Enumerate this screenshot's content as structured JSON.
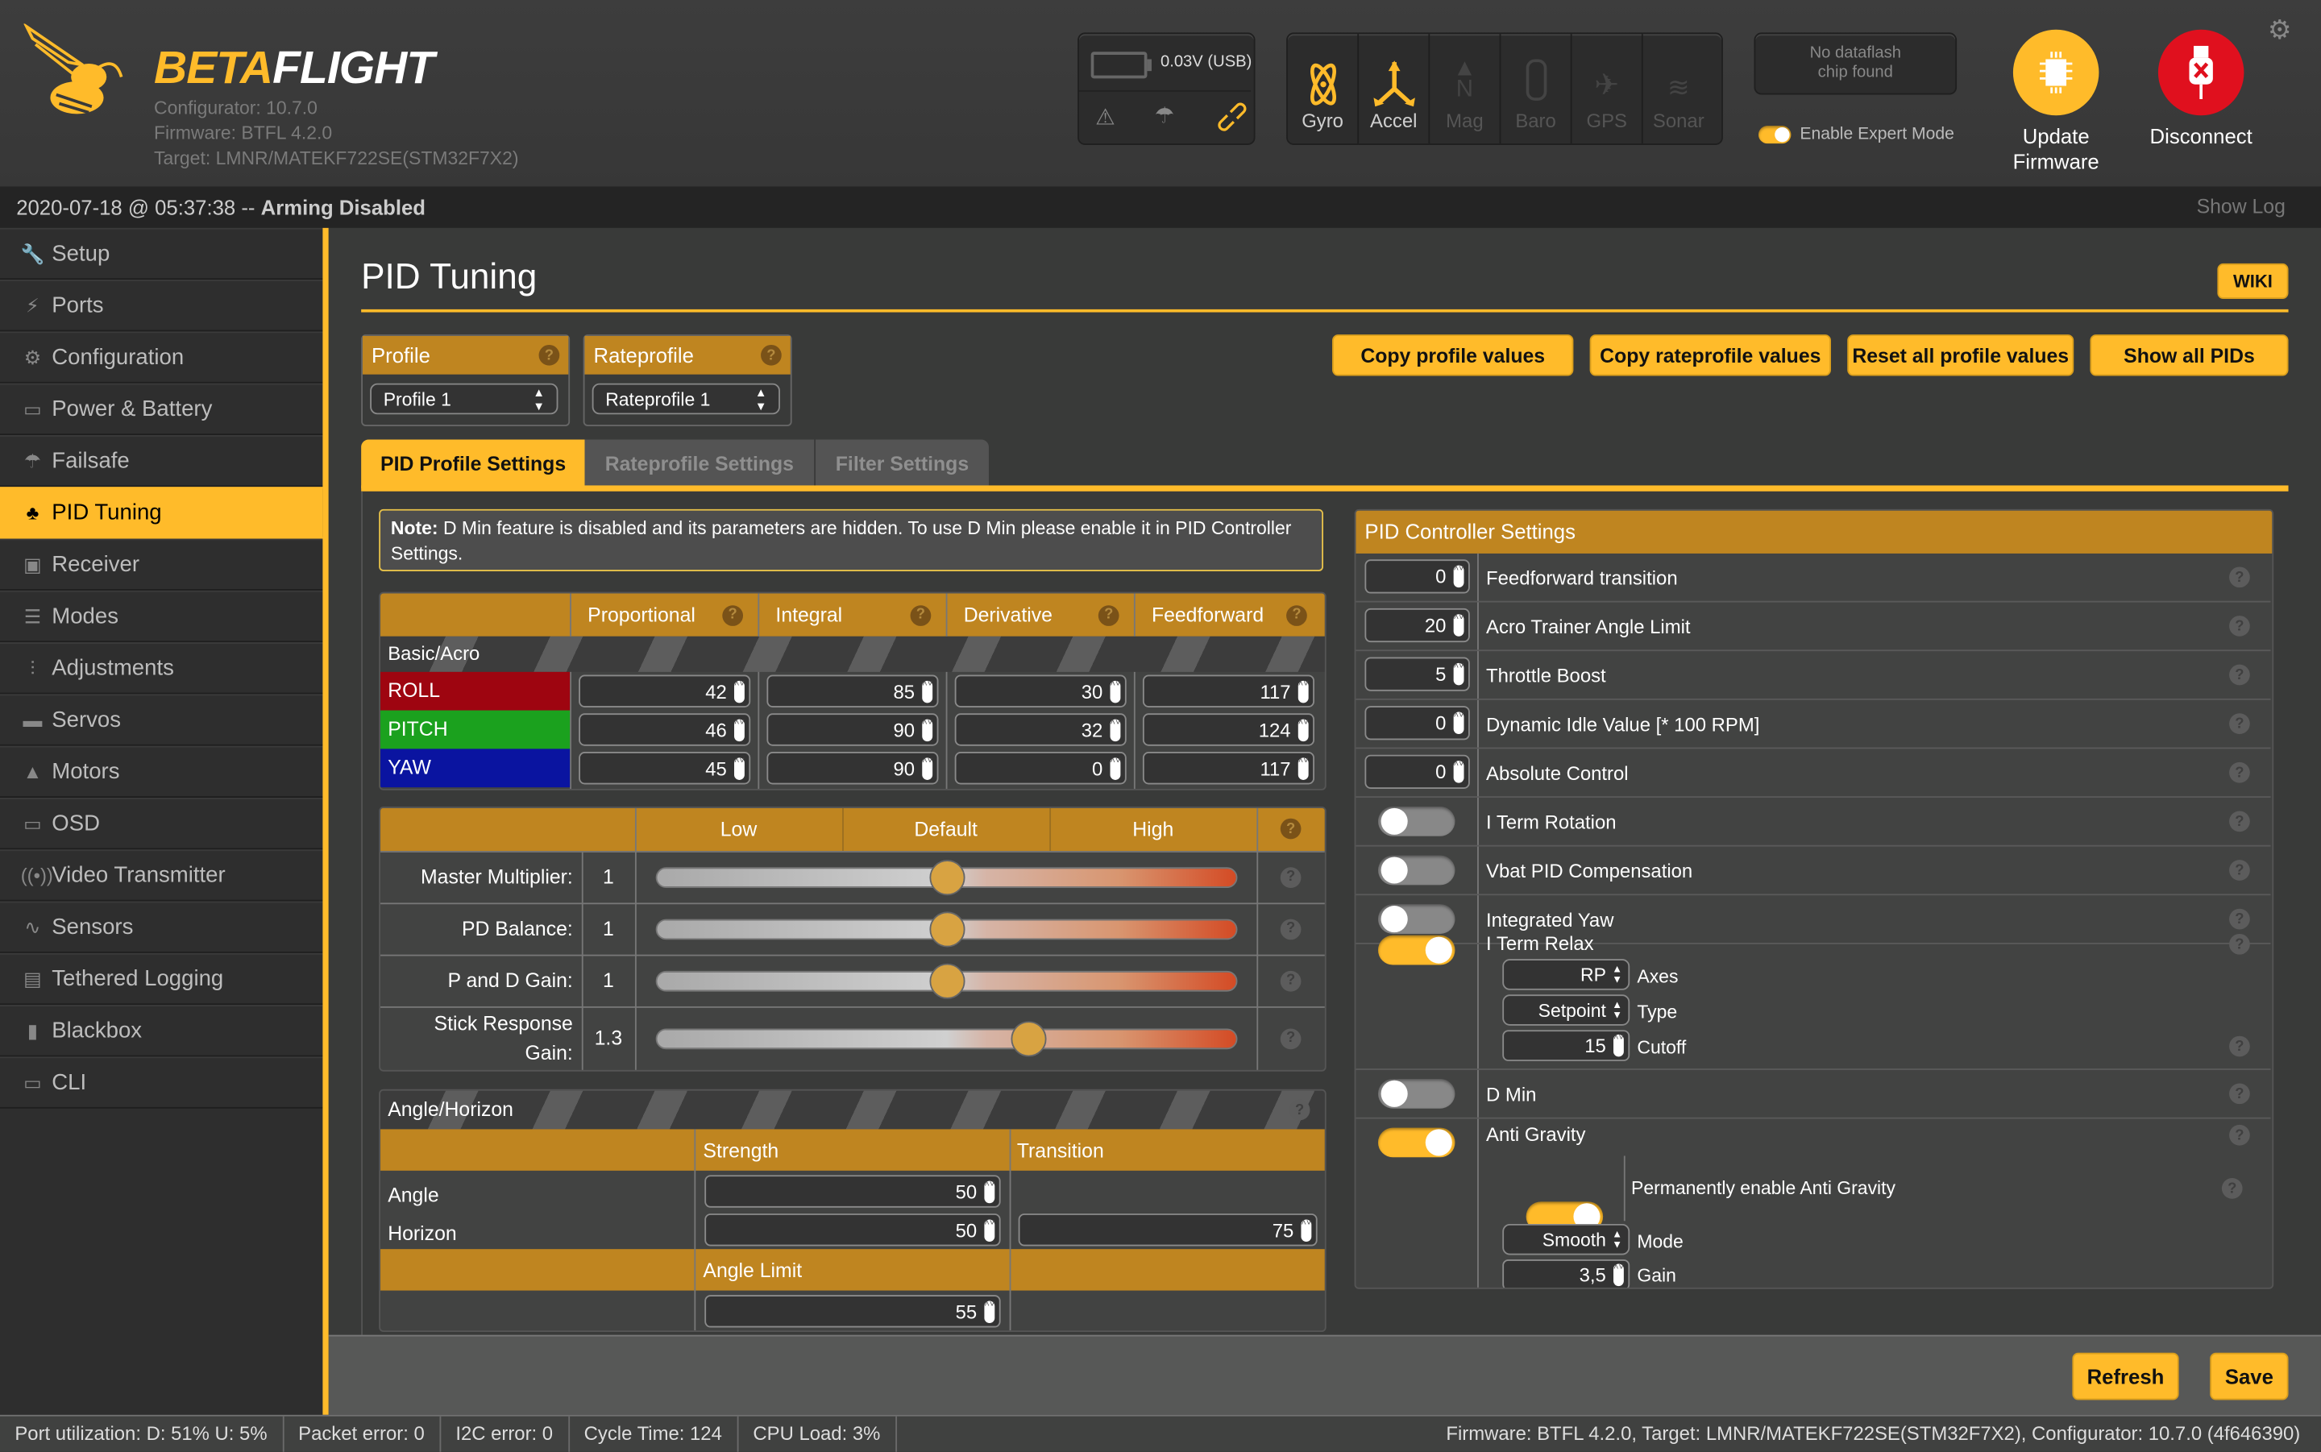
{
  "app": {
    "logo_part1": "BETA",
    "logo_part2": "FLIGHT",
    "configurator_version": "Configurator: 10.7.0",
    "firmware_version": "Firmware: BTFL 4.2.0",
    "target": "Target: LMNR/MATEKF722SE(STM32F7X2)"
  },
  "header": {
    "battery_voltage": "0.03V (USB)",
    "sensors": [
      {
        "label": "Gyro",
        "icon": "gyro-icon",
        "active": true
      },
      {
        "label": "Accel",
        "icon": "accel-icon",
        "active": true
      },
      {
        "label": "Mag",
        "icon": "mag-icon",
        "active": false
      },
      {
        "label": "Baro",
        "icon": "baro-icon",
        "active": false
      },
      {
        "label": "GPS",
        "icon": "gps-icon",
        "active": false
      },
      {
        "label": "Sonar",
        "icon": "sonar-icon",
        "active": false
      }
    ],
    "dataflash_status_line1": "No dataflash",
    "dataflash_status_line2": "chip found",
    "expert_mode_label": "Enable Expert Mode",
    "expert_mode_enabled": true,
    "update_firmware_line1": "Update",
    "update_firmware_line2": "Firmware",
    "disconnect_label": "Disconnect"
  },
  "status_line": {
    "timestamp": "2020-07-18 @ 05:37:38 -- ",
    "arming_status": "Arming Disabled",
    "show_log": "Show Log"
  },
  "sidebar": {
    "items": [
      {
        "label": "Setup",
        "icon": "wrench-icon",
        "glyph": "🔧"
      },
      {
        "label": "Ports",
        "icon": "plug-icon",
        "glyph": "⚡"
      },
      {
        "label": "Configuration",
        "icon": "gear-icon",
        "glyph": "⚙"
      },
      {
        "label": "Power & Battery",
        "icon": "battery-icon",
        "glyph": "▭"
      },
      {
        "label": "Failsafe",
        "icon": "parachute-icon",
        "glyph": "☂"
      },
      {
        "label": "PID Tuning",
        "icon": "pid-tree-icon",
        "glyph": "♣",
        "active": true
      },
      {
        "label": "Receiver",
        "icon": "remote-control-icon",
        "glyph": "▣"
      },
      {
        "label": "Modes",
        "icon": "toggle-icon",
        "glyph": "☰"
      },
      {
        "label": "Adjustments",
        "icon": "sliders-icon",
        "glyph": "⫶"
      },
      {
        "label": "Servos",
        "icon": "servo-icon",
        "glyph": "▬"
      },
      {
        "label": "Motors",
        "icon": "motor-icon",
        "glyph": "▲"
      },
      {
        "label": "OSD",
        "icon": "osd-icon",
        "glyph": "▭"
      },
      {
        "label": "Video Transmitter",
        "icon": "antenna-icon",
        "glyph": "((•))"
      },
      {
        "label": "Sensors",
        "icon": "pulse-icon",
        "glyph": "∿"
      },
      {
        "label": "Tethered Logging",
        "icon": "logging-icon",
        "glyph": "▤"
      },
      {
        "label": "Blackbox",
        "icon": "blackbox-icon",
        "glyph": "▮"
      },
      {
        "label": "CLI",
        "icon": "terminal-icon",
        "glyph": "▭"
      }
    ]
  },
  "page": {
    "title": "PID Tuning",
    "wiki_label": "WIKI",
    "profile": {
      "label": "Profile",
      "selected": "Profile 1"
    },
    "rateprofile": {
      "label": "Rateprofile",
      "selected": "Rateprofile 1"
    },
    "actions": [
      "Copy profile values",
      "Copy rateprofile values",
      "Reset all profile values",
      "Show all PIDs"
    ],
    "tabs": [
      {
        "label": "PID Profile Settings",
        "active": true
      },
      {
        "label": "Rateprofile Settings",
        "active": false
      },
      {
        "label": "Filter Settings",
        "active": false
      }
    ],
    "note_bold": "Note:",
    "note_text": " D Min feature is disabled and its parameters are hidden. To use D Min please enable it in PID Controller Settings."
  },
  "pid_table": {
    "columns": [
      "Proportional",
      "Integral",
      "Derivative",
      "Feedforward"
    ],
    "section_label": "Basic/Acro",
    "rows": [
      {
        "axis": "ROLL",
        "color": "#9e0510",
        "values": [
          "42",
          "85",
          "30",
          "117"
        ]
      },
      {
        "axis": "PITCH",
        "color": "#1ba11e",
        "values": [
          "46",
          "90",
          "32",
          "124"
        ]
      },
      {
        "axis": "YAW",
        "color": "#0a14a0",
        "values": [
          "45",
          "90",
          "0",
          "117"
        ]
      }
    ]
  },
  "sliders": {
    "headers": [
      "Low",
      "Default",
      "High"
    ],
    "items": [
      {
        "label": "Master Multiplier:",
        "value": "1",
        "position": 0.5
      },
      {
        "label": "PD Balance:",
        "value": "1",
        "position": 0.5
      },
      {
        "label": "P and D Gain:",
        "value": "1",
        "position": 0.5
      },
      {
        "label_line1": "Stick Response",
        "label_line2": "Gain:",
        "value": "1.3",
        "position": 0.64
      }
    ]
  },
  "angle_horizon": {
    "section_label": "Angle/Horizon",
    "strength_header": "Strength",
    "transition_header": "Transition",
    "angle_label": "Angle",
    "angle_strength": "50",
    "horizon_label": "Horizon",
    "horizon_strength": "50",
    "horizon_transition": "75",
    "angle_limit_header": "Angle Limit",
    "angle_limit": "55"
  },
  "pid_controller": {
    "title": "PID Controller Settings",
    "numeric": [
      {
        "label": "Feedforward transition",
        "value": "0"
      },
      {
        "label": "Acro Trainer Angle Limit",
        "value": "20"
      },
      {
        "label": "Throttle Boost",
        "value": "5"
      },
      {
        "label": "Dynamic Idle Value [* 100 RPM]",
        "value": "0"
      },
      {
        "label": "Absolute Control",
        "value": "0"
      }
    ],
    "toggles": [
      {
        "label": "I Term Rotation",
        "on": false
      },
      {
        "label": "Vbat PID Compensation",
        "on": false
      },
      {
        "label": "Integrated Yaw",
        "on": false
      }
    ],
    "iterm_relax": {
      "label": "I Term Relax",
      "on": true,
      "axes_value": "RP",
      "axes_label": "Axes",
      "type_value": "Setpoint",
      "type_label": "Type",
      "cutoff_value": "15",
      "cutoff_label": "Cutoff"
    },
    "d_min": {
      "label": "D Min",
      "on": false
    },
    "anti_gravity": {
      "label": "Anti Gravity",
      "on": true,
      "permanent_label": "Permanently enable Anti Gravity",
      "permanent_on": true,
      "mode_value": "Smooth",
      "mode_label": "Mode",
      "gain_value": "3,5",
      "gain_label": "Gain"
    }
  },
  "footer": {
    "refresh_label": "Refresh",
    "save_label": "Save"
  },
  "bottom_bar": {
    "port_utilization": "Port utilization: D: 51% U: 5%",
    "packet_error": "Packet error: 0",
    "i2c_error": "I2C error: 0",
    "cycle_time": "Cycle Time: 124",
    "cpu_load": "CPU Load: 3%",
    "version_info": "Firmware: BTFL 4.2.0, Target: LMNR/MATEKF722SE(STM32F7X2), Configurator: 10.7.0 (4f646390)"
  },
  "colors": {
    "accent": "#ffbb2a",
    "header_gold": "#bf8520",
    "disconnect_red": "#e0101e"
  }
}
